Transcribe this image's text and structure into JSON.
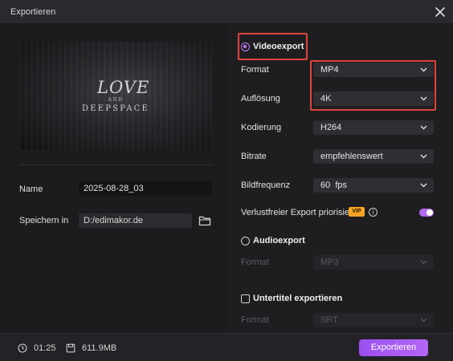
{
  "window": {
    "title": "Exportieren"
  },
  "preview": {
    "title_line1": "LOVE",
    "title_line2": "AND",
    "title_line3": "DEEPSPACE"
  },
  "left": {
    "name_label": "Name",
    "name_value": "2025-08-28_03",
    "save_label": "Speichern in",
    "save_path": "D:/edimakor.de"
  },
  "video": {
    "section_label": "Videoexport",
    "selected": true,
    "rows": [
      {
        "label": "Format",
        "value": "MP4"
      },
      {
        "label": "Auflösung",
        "value": "4K"
      },
      {
        "label": "Kodierung",
        "value": "H264"
      },
      {
        "label": "Bitrate",
        "value": "empfehlenswert"
      },
      {
        "label": "Bildfrequenz",
        "value": "60  fps"
      }
    ],
    "lossless_label": "Verlustfreier Export priorisiert",
    "vip_badge": "VIP",
    "lossless_on": true
  },
  "audio": {
    "section_label": "Audioexport",
    "selected": false,
    "format_label": "Format",
    "format_value": "MP3"
  },
  "subtitle": {
    "section_label": "Untertitel exportieren",
    "checked": false,
    "format_label": "Format",
    "format_value": "SRT"
  },
  "footer": {
    "duration": "01:25",
    "size": "611.9MB",
    "export_button": "Exportieren"
  },
  "colors": {
    "accent": "#b368f6",
    "highlight": "#e0443a",
    "background": "#1e1e21",
    "vip": "#f5a524"
  },
  "icons": {
    "close": "close-icon",
    "folder": "folder-icon",
    "chevron": "chevron-down-icon",
    "info": "info-icon",
    "clock": "clock-icon",
    "size": "storage-icon"
  }
}
